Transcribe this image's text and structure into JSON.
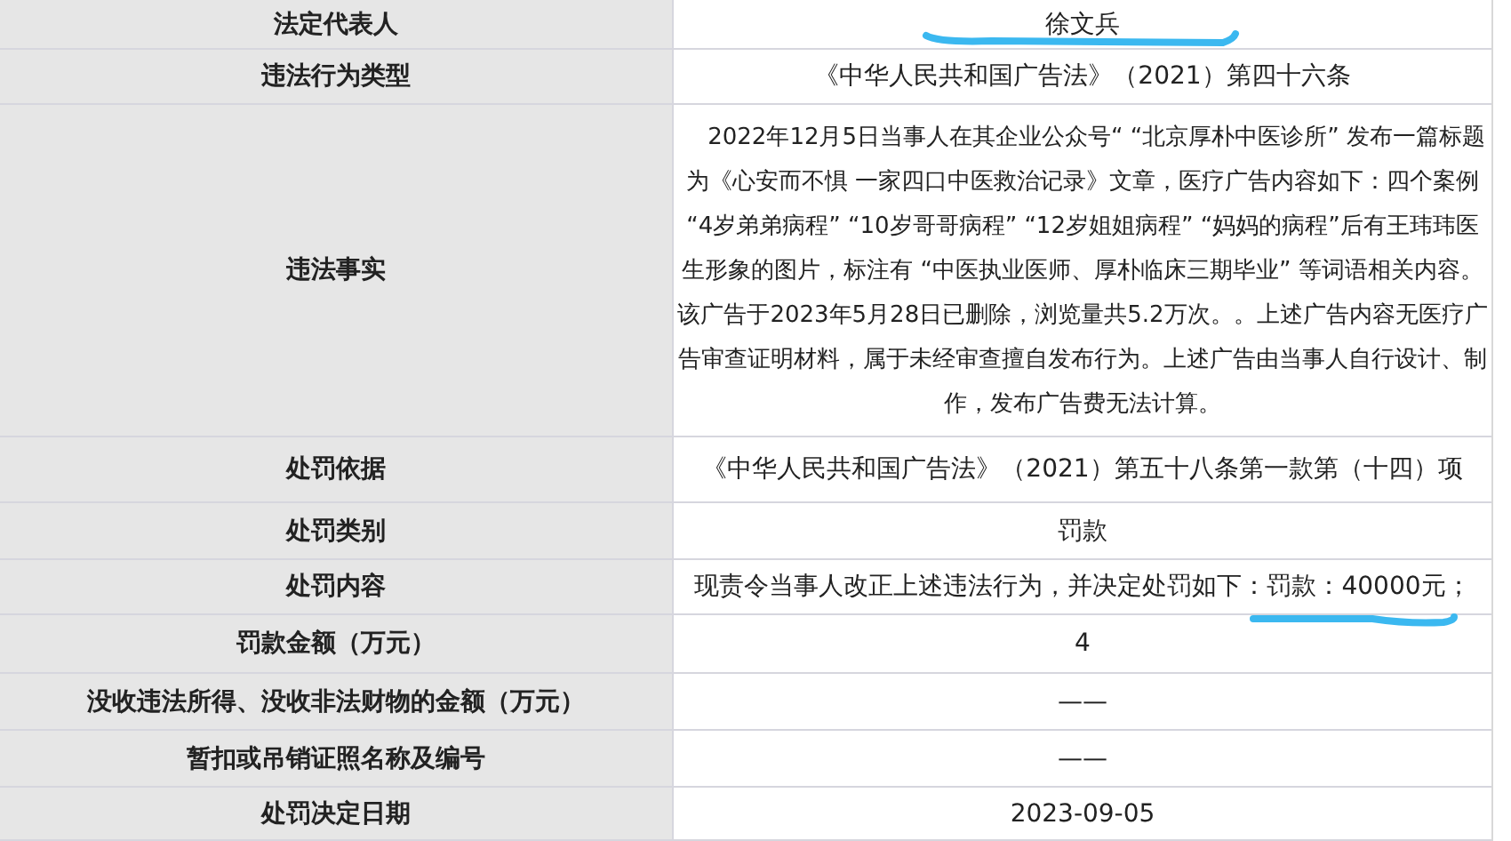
{
  "rows": [
    {
      "label": "法定代表人",
      "value": "徐文兵",
      "kind": "plain"
    },
    {
      "label": "违法行为类型",
      "value": "《中华人民共和国广告法》（2021）第四十六条",
      "kind": "plain"
    },
    {
      "label": "违法事实",
      "value": "2022年12月5日当事人在其企业公众号“ “北京厚朴中医诊所” 发布一篇标题为《心安而不惧 一家四口中医救治记录》文章，医疗广告内容如下：四个案例 “4岁弟弟病程” “10岁哥哥病程” “12岁姐姐病程” “妈妈的病程”后有王玮玮医生形象的图片，标注有 “中医执业医师、厚朴临床三期毕业” 等词语相关内容。该广告于2023年5月28日已删除，浏览量共5.2万次。。上述广告内容无医疗广告审查证明材料，属于未经审查擅自发布行为。上述广告由当事人自行设计、制作，发布广告费无法计算。",
      "kind": "paragraph"
    },
    {
      "label": "处罚依据",
      "value": "《中华人民共和国广告法》（2021）第五十八条第一款第（十四）项",
      "kind": "plain"
    },
    {
      "label": "处罚类别",
      "value": "罚款",
      "kind": "plain"
    },
    {
      "label": "处罚内容",
      "value": "现责令当事人改正上述违法行为，并决定处罚如下：罚款：40000元；",
      "kind": "plain"
    },
    {
      "label": "罚款金额（万元）",
      "value": "4",
      "kind": "plain"
    },
    {
      "label": "没收违法所得、没收非法财物的金额（万元）",
      "value": "——",
      "kind": "plain"
    },
    {
      "label": "暂扣或吊销证照名称及编号",
      "value": "——",
      "kind": "plain"
    },
    {
      "label": "处罚决定日期",
      "value": "2023-09-05",
      "kind": "plain"
    }
  ]
}
